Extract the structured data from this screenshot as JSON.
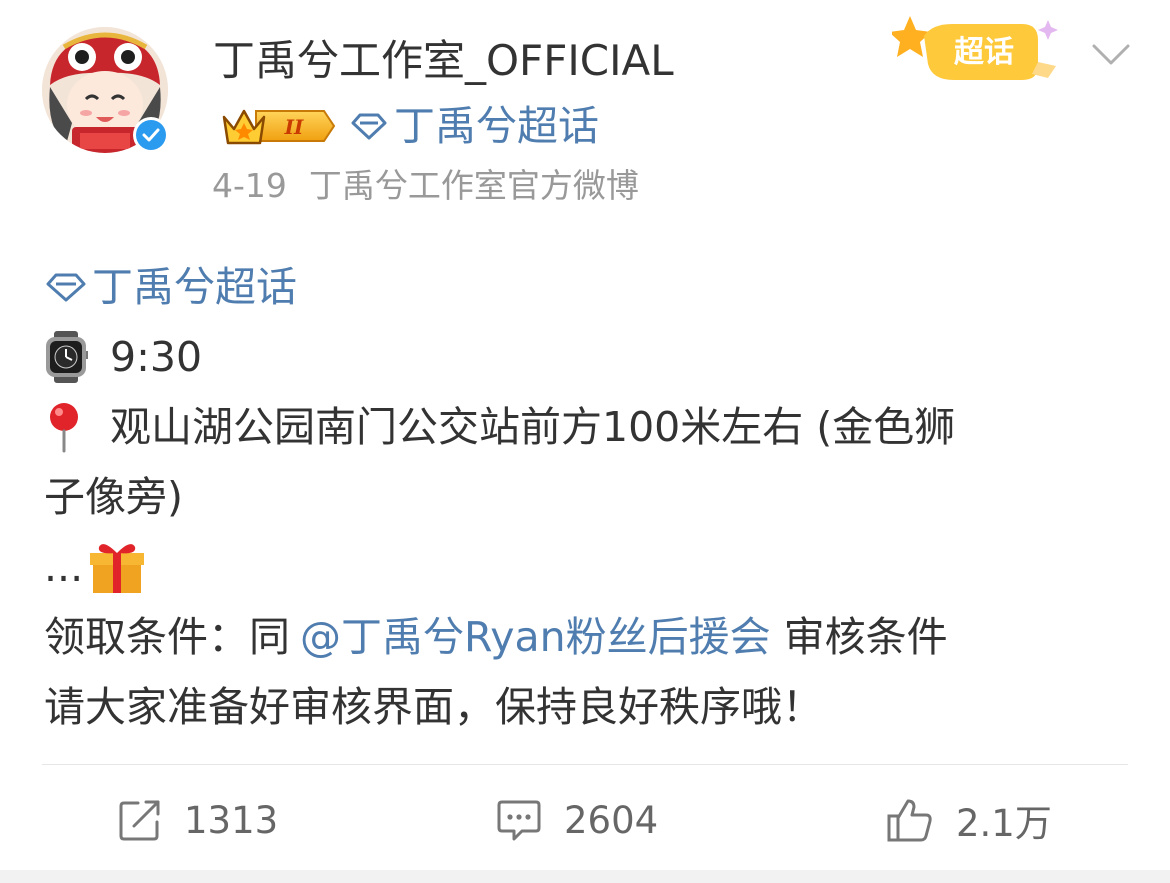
{
  "post": {
    "username": "丁禹兮工作室_OFFICIAL",
    "badge_level": "II",
    "topic_badge_label": "丁禹兮超话",
    "date": "4-19",
    "source": "丁禹兮工作室官方微博",
    "supertopic_tag": "超话",
    "content": {
      "topic": "丁禹兮超话",
      "time": "9:30",
      "location_line1": "观山湖公园南门公交站前方100米左右 (金色狮",
      "location_line2": "子像旁)",
      "ellipsis": "...",
      "condition_prefix": "领取条件：同",
      "condition_mention": "@丁禹兮Ryan粉丝后援会",
      "condition_suffix": " 审核条件",
      "closing": "请大家准备好审核界面，保持良好秩序哦！"
    }
  },
  "actions": {
    "repost_count": "1313",
    "comment_count": "2604",
    "like_count": "2.1万"
  },
  "colors": {
    "link": "#507daf",
    "text": "#333333",
    "meta": "#999999",
    "verified": "#2b9bf0",
    "tag": "#f7b733"
  }
}
